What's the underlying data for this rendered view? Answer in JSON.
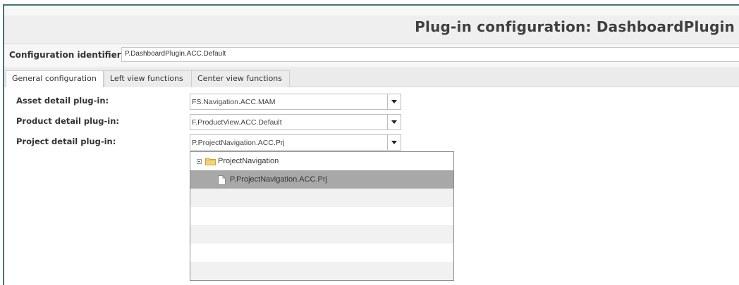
{
  "header": {
    "title": "Plug-in configuration: DashboardPlugin"
  },
  "identifier": {
    "label": "Configuration identifier",
    "value": "P.DashboardPlugin.ACC.Default"
  },
  "tabs": [
    {
      "label": "General configuration",
      "active": true
    },
    {
      "label": "Left view functions",
      "active": false
    },
    {
      "label": "Center view functions",
      "active": false
    }
  ],
  "fields": [
    {
      "label": "Asset detail plug-in:",
      "value": "FS.Navigation.ACC.MAM"
    },
    {
      "label": "Product detail plug-in:",
      "value": "F.ProductView.ACC.Default"
    },
    {
      "label": "Project detail plug-in:",
      "value": "P.ProjectNavigation.ACC.Prj"
    }
  ],
  "dropdown": {
    "folder": {
      "label": "ProjectNavigation",
      "icon": "folder-icon",
      "expanded": true
    },
    "items": [
      {
        "label": "P.ProjectNavigation.ACC.Prj",
        "icon": "document-icon",
        "selected": true
      }
    ]
  },
  "colors": {
    "frame_border": "#4a7272",
    "selected_row": "#a8a8a8",
    "title_text": "#404040"
  }
}
